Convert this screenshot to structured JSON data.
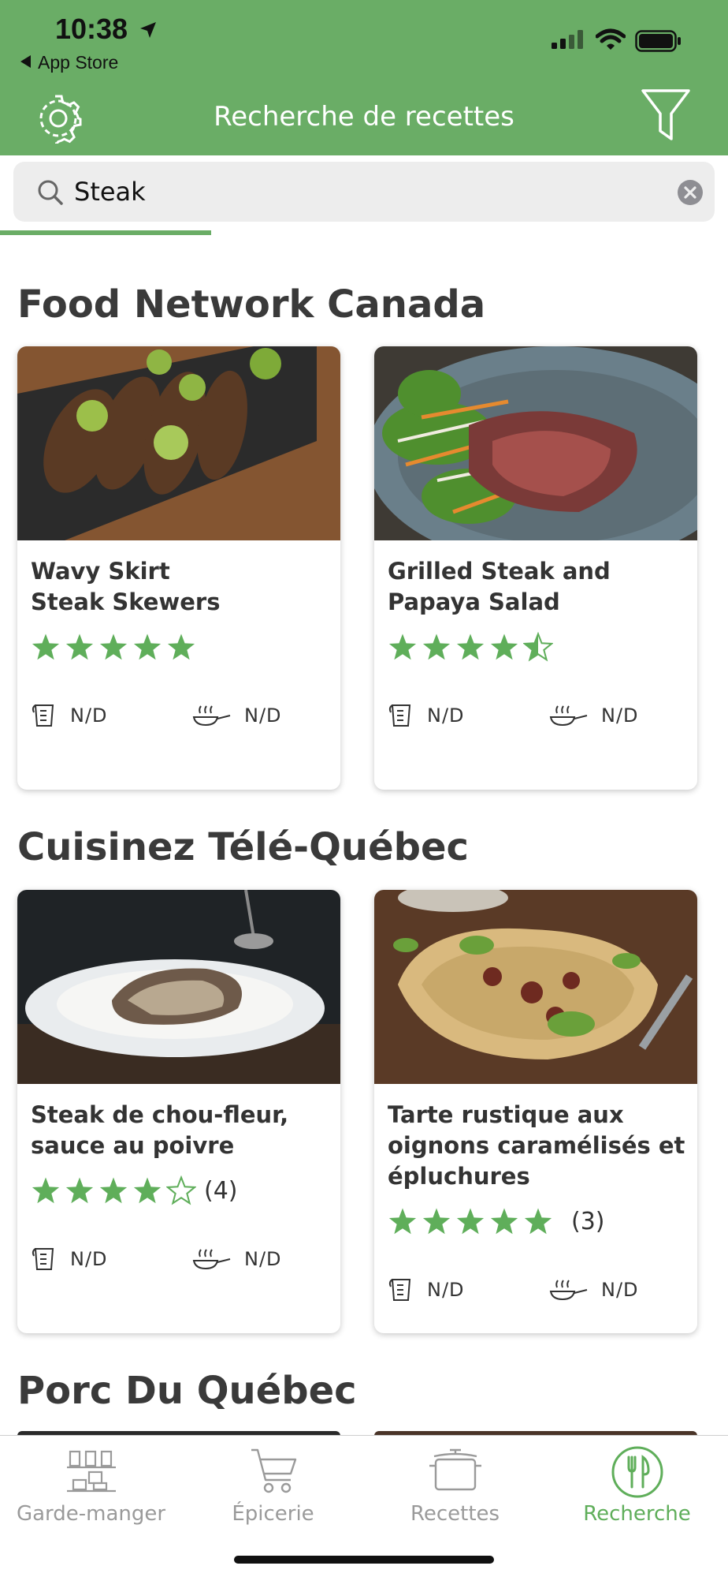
{
  "status_bar": {
    "time": "10:38",
    "back_label": "App Store"
  },
  "header": {
    "title": "Recherche de recettes"
  },
  "search": {
    "value": "Steak"
  },
  "progress": {
    "fraction": 0.29
  },
  "sections": [
    {
      "title": "Food Network Canada",
      "cards": [
        {
          "title_line1": "Wavy Skirt",
          "title_line2": "Steak Skewers",
          "rating": 5,
          "count": "",
          "prep": "N/D",
          "cook": "N/D"
        },
        {
          "title_line1": "Grilled Steak and",
          "title_line2": "Papaya Salad",
          "rating": 4.5,
          "count": "",
          "prep": "N/D",
          "cook": "N/D"
        }
      ]
    },
    {
      "title": "Cuisinez Télé-Québec",
      "cards": [
        {
          "title_line1": "Steak de chou-fleur,",
          "title_line2": "sauce au poivre",
          "rating": 4,
          "count": "(4)",
          "prep": "N/D",
          "cook": "N/D"
        },
        {
          "title_line1": "Tarte rustique aux",
          "title_line2": "oignons caramélisés et",
          "title_line3": "épluchures",
          "rating": 5,
          "count": "(3)",
          "prep": "N/D",
          "cook": "N/D"
        }
      ]
    },
    {
      "title": "Porc Du Québec"
    }
  ],
  "tabs": [
    {
      "label": "Garde-manger",
      "icon": "pantry-shelf-icon",
      "active": false
    },
    {
      "label": "Épicerie",
      "icon": "shopping-cart-icon",
      "active": false
    },
    {
      "label": "Recettes",
      "icon": "cooking-pot-icon",
      "active": false
    },
    {
      "label": "Recherche",
      "icon": "fork-knife-icon",
      "active": true
    }
  ],
  "colors": {
    "brand_green": "#6aad66",
    "star_green": "#5fae5a",
    "inactive_tab": "#9a9a9a"
  }
}
